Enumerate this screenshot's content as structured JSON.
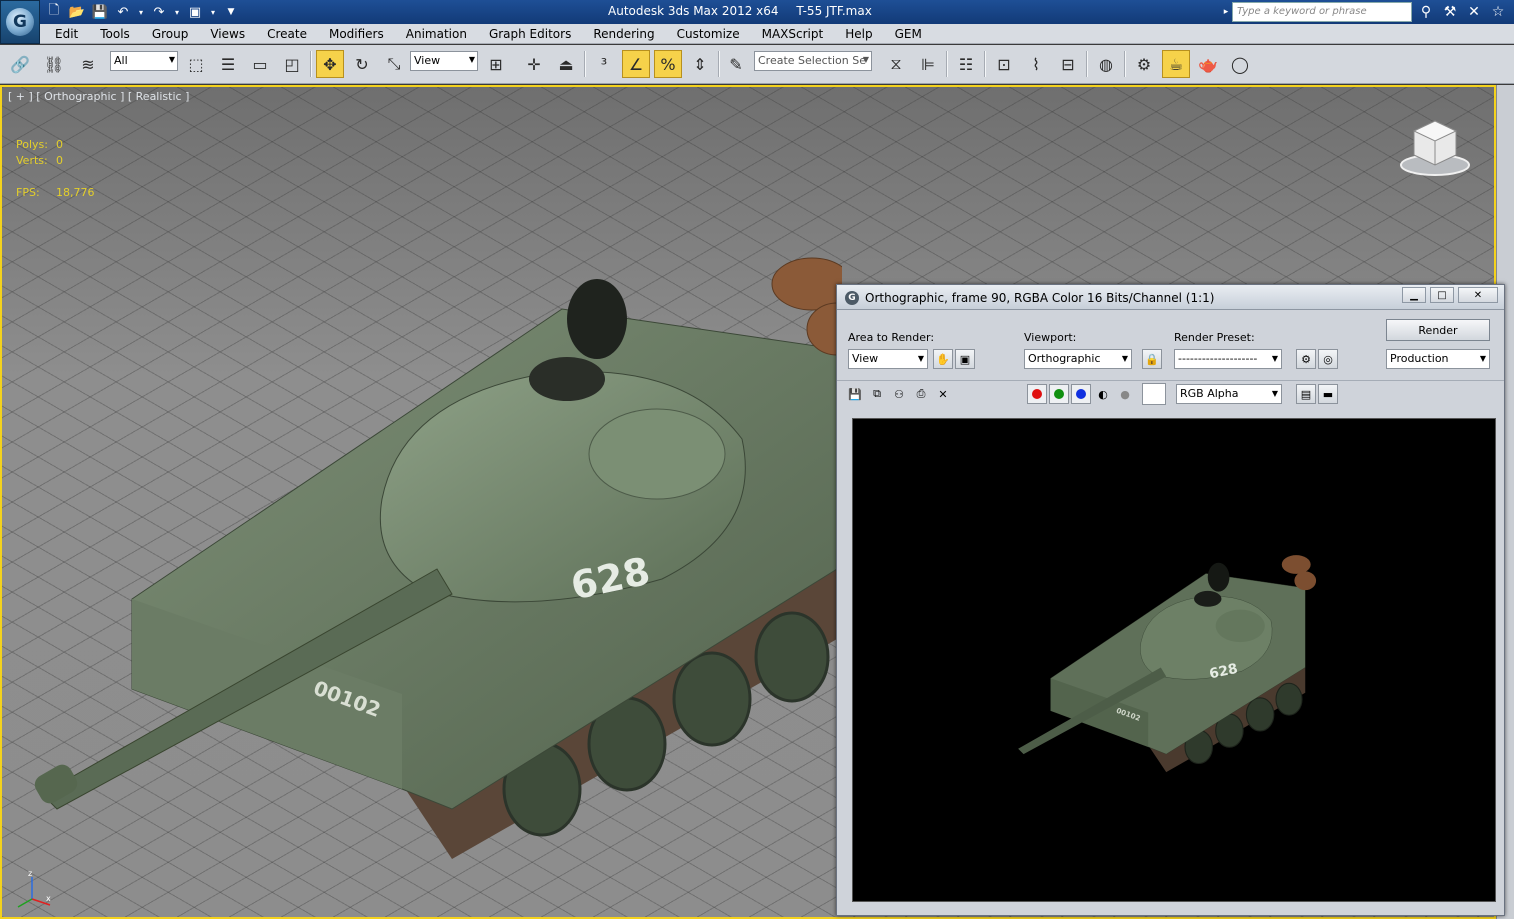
{
  "app": {
    "title": "Autodesk 3ds Max  2012 x64",
    "file": "T-55 JTF.max",
    "search_placeholder": "Type a keyword or phrase"
  },
  "menu": [
    "Edit",
    "Tools",
    "Group",
    "Views",
    "Create",
    "Modifiers",
    "Animation",
    "Graph Editors",
    "Rendering",
    "Customize",
    "MAXScript",
    "Help",
    "GEM"
  ],
  "toolbar": {
    "selection_filter": "All",
    "reference_coord": "View",
    "named_selection_placeholder": "Create Selection Se"
  },
  "viewport": {
    "label": "[ + ] [ Orthographic ] [ Realistic ]",
    "stats": [
      {
        "key": "Polys:",
        "value": "0"
      },
      {
        "key": "Verts:",
        "value": "0"
      }
    ],
    "fps_key": "FPS:",
    "fps_value": "18,776",
    "tank_marking": "628",
    "hull_marking": "00102",
    "axis_z": "z",
    "axis_x": "x"
  },
  "render_window": {
    "title": "Orthographic, frame 90, RGBA Color 16 Bits/Channel (1:1)",
    "area_label": "Area to Render:",
    "area_value": "View",
    "viewport_label": "Viewport:",
    "viewport_value": "Orthographic",
    "preset_label": "Render Preset:",
    "preset_value": "--------------------",
    "render_button": "Render",
    "production_value": "Production",
    "channel_value": "RGB Alpha",
    "channel_colors": {
      "red": "#e01010",
      "green": "#109010",
      "blue": "#1030e0"
    },
    "controls": {
      "minimize": "▁",
      "maximize": "□",
      "close": "✕"
    }
  }
}
